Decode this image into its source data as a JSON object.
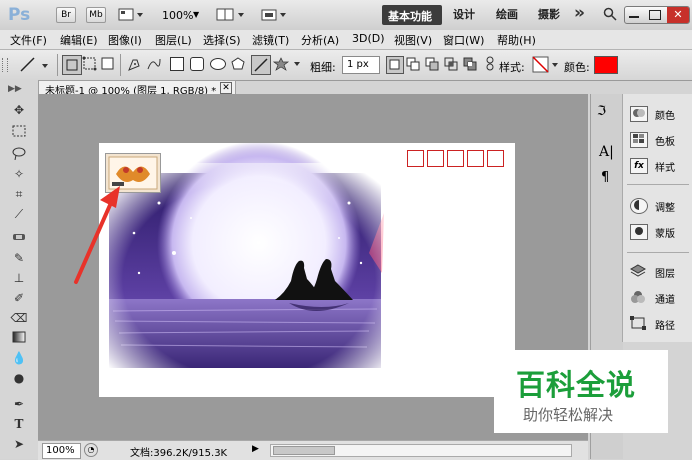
{
  "app": {
    "logo": "Ps",
    "br_button": "Br",
    "mb_button": "Mb",
    "zoom": "100%",
    "workspaces": [
      "基本功能",
      "设计",
      "绘画",
      "摄影"
    ],
    "more": "»"
  },
  "menu": [
    "文件(F)",
    "编辑(E)",
    "图像(I)",
    "图层(L)",
    "选择(S)",
    "滤镜(T)",
    "分析(A)",
    "3D(D)",
    "视图(V)",
    "窗口(W)",
    "帮助(H)"
  ],
  "options": {
    "weight_label": "粗细:",
    "weight_value": "1 px",
    "style_label": "样式:",
    "color_label": "颜色:",
    "color": "#ff0000"
  },
  "document": {
    "tab_title": "未标题-1 @ 100% (图层 1, RGB/8) *",
    "zoom": "100%",
    "doc_info": "文档:396.2K/915.3K",
    "postcode_boxes": 5,
    "postcode_color": "#cc2222"
  },
  "panels": {
    "group1": [
      "颜色",
      "色板",
      "样式"
    ],
    "group2": [
      "调整",
      "蒙版"
    ],
    "group3": [
      "图层",
      "通道",
      "路径"
    ]
  },
  "watermark": {
    "title": "百科全说",
    "subtitle": "助你轻松解决"
  }
}
